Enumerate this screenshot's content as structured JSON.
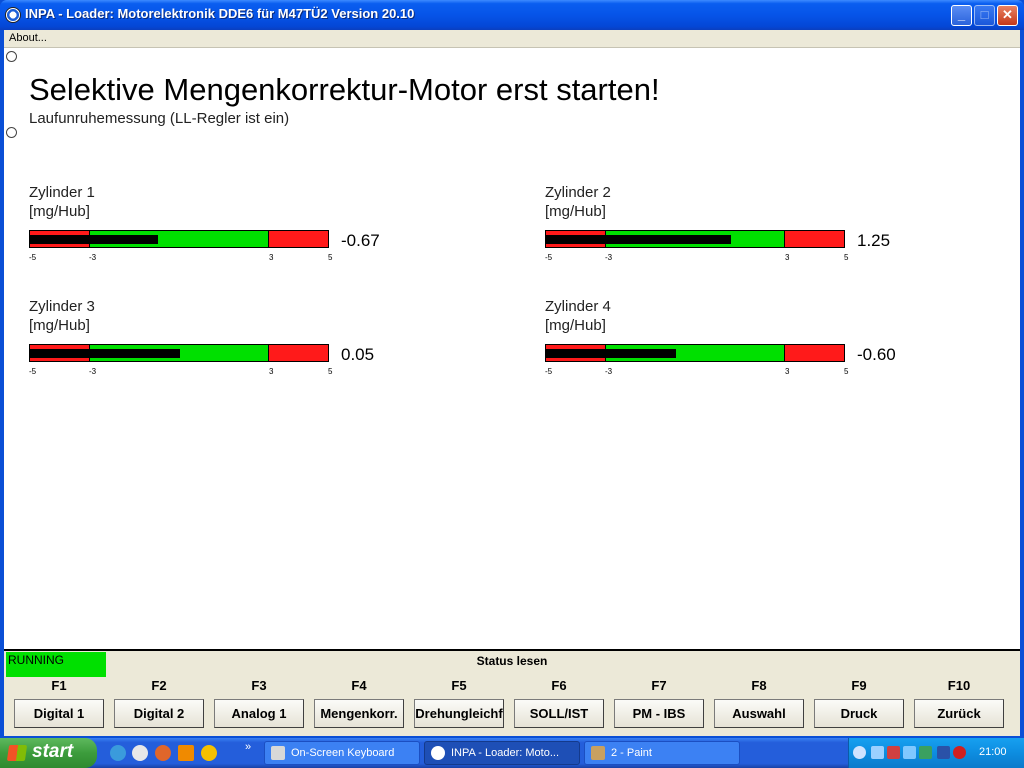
{
  "window": {
    "title": "INPA - Loader:  Motorelektronik DDE6 für M47TÜ2 Version 20.10",
    "controls": {
      "minimize": "_",
      "maximize": "□",
      "close": "✕"
    }
  },
  "menu": {
    "about": "About..."
  },
  "main": {
    "heading": "Selektive Mengenkorrektur-Motor erst starten!",
    "subheading": "Laufunruhemessung (LL-Regler ist ein)"
  },
  "gauges": [
    {
      "name": "Zylinder 1",
      "unit": "[mg/Hub]",
      "value": "-0.67",
      "fill_fraction": 0.43,
      "ticks": [
        "-5",
        "-3",
        "3",
        "5"
      ]
    },
    {
      "name": "Zylinder 2",
      "unit": "[mg/Hub]",
      "value": "1.25",
      "fill_fraction": 0.62,
      "ticks": [
        "-5",
        "-3",
        "3",
        "5"
      ]
    },
    {
      "name": "Zylinder 3",
      "unit": "[mg/Hub]",
      "value": "0.05",
      "fill_fraction": 0.505,
      "ticks": [
        "-5",
        "-3",
        "3",
        "5"
      ]
    },
    {
      "name": "Zylinder 4",
      "unit": "[mg/Hub]",
      "value": "-0.60",
      "fill_fraction": 0.435,
      "ticks": [
        "-5",
        "-3",
        "3",
        "5"
      ]
    }
  ],
  "status": {
    "state": "RUNNING",
    "title": "Status lesen",
    "state_color": "#00e000"
  },
  "function_keys": [
    {
      "key": "F1",
      "label": "Digital 1"
    },
    {
      "key": "F2",
      "label": "Digital 2"
    },
    {
      "key": "F3",
      "label": "Analog 1"
    },
    {
      "key": "F4",
      "label": "Mengenkorr."
    },
    {
      "key": "F5",
      "label": "Drehungleichf"
    },
    {
      "key": "F6",
      "label": "SOLL/IST"
    },
    {
      "key": "F7",
      "label": "PM - IBS"
    },
    {
      "key": "F8",
      "label": "Auswahl"
    },
    {
      "key": "F9",
      "label": "Druck"
    },
    {
      "key": "F10",
      "label": "Zurück"
    }
  ],
  "taskbar": {
    "start_label": "start",
    "tasks": [
      {
        "label": "On-Screen Keyboard",
        "icon": "keyboard-icon"
      },
      {
        "label": "INPA - Loader:  Moto...",
        "icon": "bmw-icon"
      },
      {
        "label": "2 - Paint",
        "icon": "paint-icon"
      }
    ],
    "clock": "21:00"
  },
  "colors": {
    "gauge_ok": "#00e000",
    "gauge_limit": "#ff1a1a",
    "gauge_fill": "#000000",
    "titlebar": "#0654e8"
  }
}
